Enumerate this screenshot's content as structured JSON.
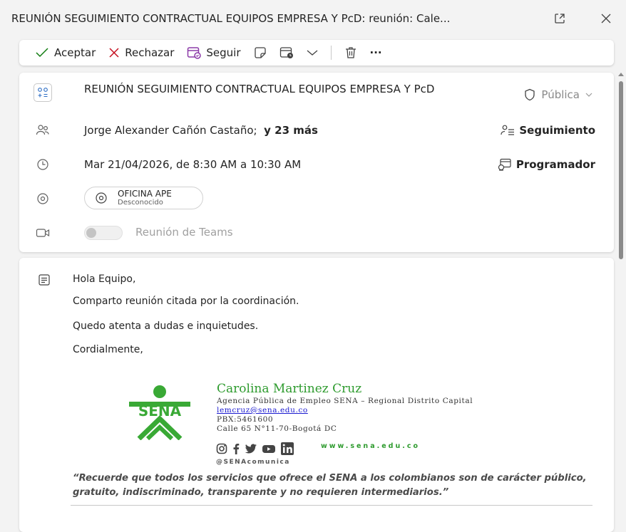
{
  "window": {
    "title": "REUNIÓN SEGUIMIENTO CONTRACTUAL EQUIPOS EMPRESA Y PcD: reunión: Cale..."
  },
  "toolbar": {
    "accept_label": "Aceptar",
    "reject_label": "Rechazar",
    "follow_label": "Seguir",
    "more_label": "···"
  },
  "event": {
    "subject": "REUNIÓN SEGUIMIENTO CONTRACTUAL EQUIPOS EMPRESA Y PcD",
    "visibility": "Pública",
    "attendees_name": "Jorge Alexander Cañón Castaño;",
    "attendees_more": "y 23 más",
    "tracking_label": "Seguimiento",
    "datetime": "Mar 21/04/2026, de 8:30 AM a 10:30 AM",
    "scheduler_label": "Programador",
    "location_name": "OFICINA APE",
    "location_status": "Desconocido",
    "teams_label": "Reunión de Teams"
  },
  "body": {
    "greeting": "Hola Equipo,",
    "line1": "Comparto reunión citada por la coordinación.",
    "line2": "Quedo atenta a dudas e inquietudes.",
    "closing": "Cordialmente,",
    "signature": {
      "name": "Carolina Martinez Cruz",
      "org": "Agencia Pública de Empleo SENA – Regional Distrito Capital",
      "email": "lemcruz@sena.edu.co",
      "phone": "PBX:5461600",
      "address": "Calle 65 N°11-70-Bogotá DC",
      "website": "www.sena.edu.co",
      "handle": "@SENAcomunica",
      "logo_text": "SENA"
    },
    "quote": "“Recuerde que todos los servicios que ofrece el SENA a los colombianos son de carácter público, gratuito, indiscriminado, transparente y no requieren intermediarios.”"
  },
  "colors": {
    "accept": "#107c10",
    "reject": "#c50f1f",
    "follow": "#8b3aa8",
    "sena_green": "#39a935"
  }
}
